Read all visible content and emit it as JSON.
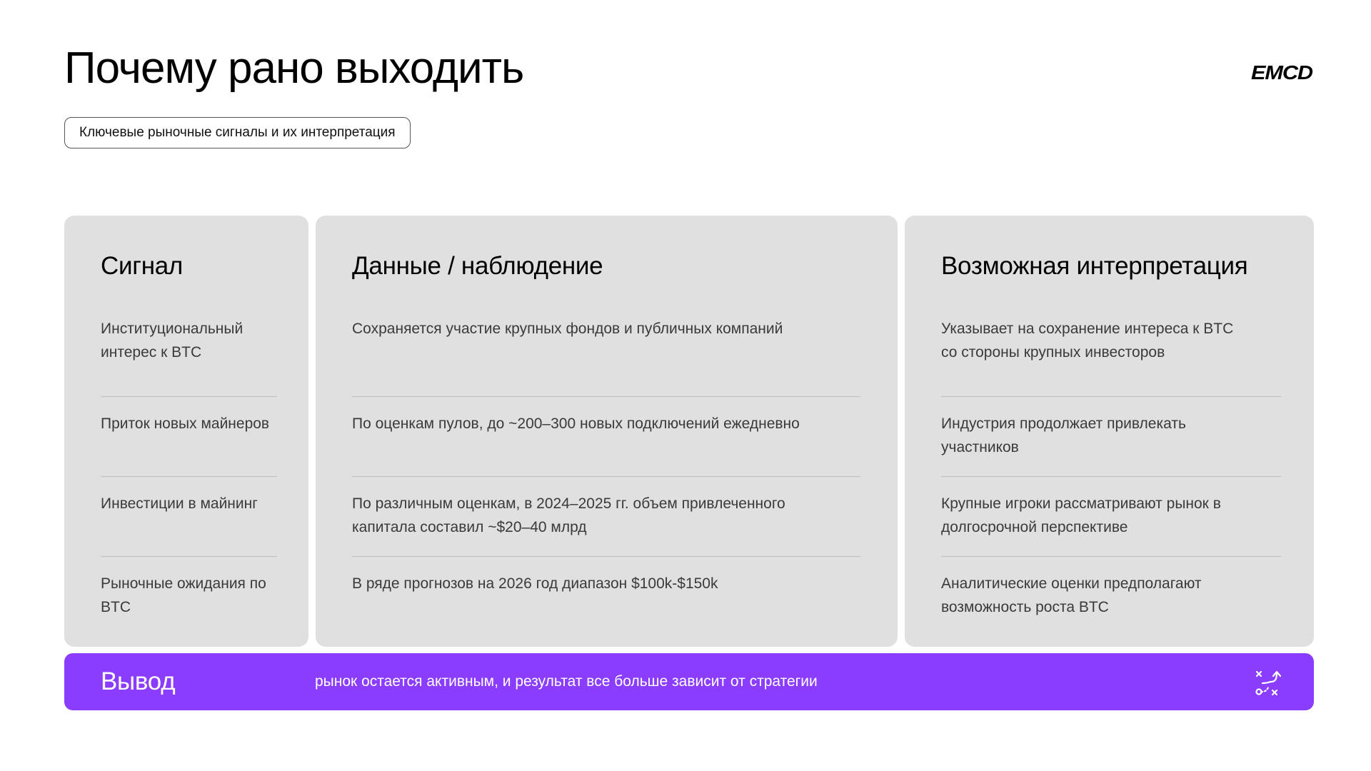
{
  "header": {
    "title": "Почему рано выходить",
    "subtitle": "Ключевые рыночные сигналы и их интерпретация",
    "logo_text": "EMCD"
  },
  "columns": [
    {
      "heading": "Сигнал",
      "rows": [
        "Институциональный интерес к BTC",
        "Приток новых майнеров",
        "Инвестиции в майнинг",
        "Рыночные ожидания по BTC"
      ]
    },
    {
      "heading": "Данные / наблюдение",
      "rows": [
        "Сохраняется участие крупных фондов и публичных компаний",
        "По оценкам пулов, до ~200–300 новых подключений ежедневно",
        "По различным оценкам, в 2024–2025 гг. объем привлеченного капитала составил ~$20–40 млрд",
        "В ряде прогнозов на 2026 год диапазон $100k-$150k"
      ]
    },
    {
      "heading": "Возможная интерпретация",
      "rows": [
        "Указывает на сохранение интереса к BTC со стороны крупных инвесторов",
        "Индустрия продолжает привлекать участников",
        "Крупные игроки рассматривают рынок в долгосрочной перспективе",
        "Аналитические оценки предполагают возможность роста BTC"
      ]
    }
  ],
  "conclusion": {
    "label": "Вывод",
    "text": "рынок остается активным, и результат все больше зависит от стратегии",
    "icon": "strategy-icon"
  },
  "colors": {
    "accent": "#8b3dff",
    "card_bg": "#e0e0e0",
    "background": "#ffffff"
  }
}
